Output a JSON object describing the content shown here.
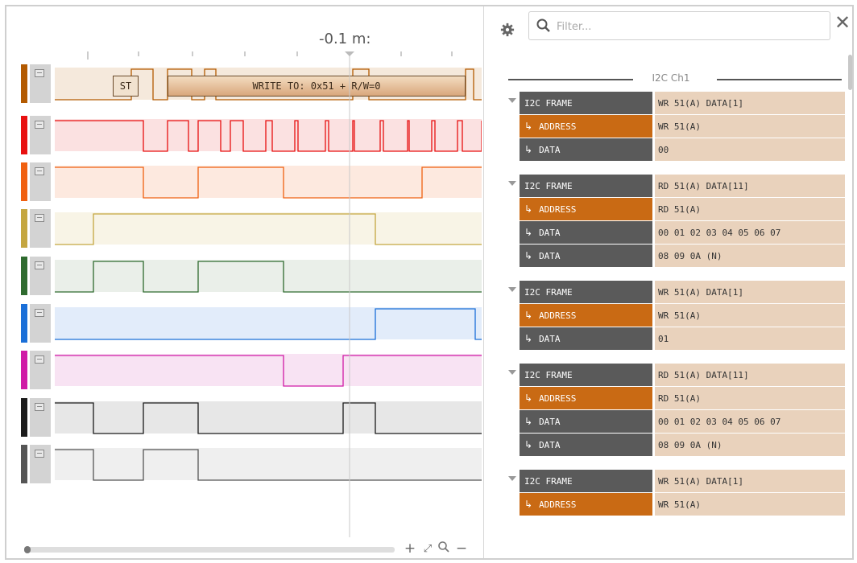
{
  "wave": {
    "time_label": "-0.1 m:",
    "start_label": "ST",
    "write_label": "WRITE TO: 0x51 + R/W=0",
    "channels": [
      {
        "color": "#b35a00",
        "bg": "#f5e9dc"
      },
      {
        "color": "#e81010",
        "bg": "#fbe1e1"
      },
      {
        "color": "#f06010",
        "bg": "#fde9df"
      },
      {
        "color": "#c4a640",
        "bg": "#f8f4e6"
      },
      {
        "color": "#2e6a2e",
        "bg": "#eaefe9"
      },
      {
        "color": "#1a6fd8",
        "bg": "#e2ecfa"
      },
      {
        "color": "#d01aa6",
        "bg": "#f8e3f3"
      },
      {
        "color": "#1b1b1b",
        "bg": "#e7e7e7"
      },
      {
        "color": "#555555",
        "bg": "#efefef"
      }
    ],
    "zoom_controls": [
      "+",
      "⤢",
      "🔍",
      "−"
    ]
  },
  "panel": {
    "filter_placeholder": "Filter...",
    "close_glyph": "✕",
    "group_name": "I2C Ch1",
    "frames": [
      {
        "label": "I2C FRAME",
        "value": "WR 51(A) DATA[1]",
        "children": [
          {
            "type": "address",
            "label": "ADDRESS",
            "value": "WR 51(A)"
          },
          {
            "type": "data",
            "label": "DATA",
            "value": "00"
          }
        ]
      },
      {
        "label": "I2C FRAME",
        "value": "RD 51(A) DATA[11]",
        "children": [
          {
            "type": "address",
            "label": "ADDRESS",
            "value": "RD 51(A)"
          },
          {
            "type": "data",
            "label": "DATA",
            "value": "00 01 02 03 04 05 06 07"
          },
          {
            "type": "data",
            "label": "DATA",
            "value": "08 09 0A (N)"
          }
        ]
      },
      {
        "label": "I2C FRAME",
        "value": "WR 51(A) DATA[1]",
        "children": [
          {
            "type": "address",
            "label": "ADDRESS",
            "value": "WR 51(A)"
          },
          {
            "type": "data",
            "label": "DATA",
            "value": "01"
          }
        ]
      },
      {
        "label": "I2C FRAME",
        "value": "RD 51(A) DATA[11]",
        "children": [
          {
            "type": "address",
            "label": "ADDRESS",
            "value": "RD 51(A)"
          },
          {
            "type": "data",
            "label": "DATA",
            "value": "00 01 02 03 04 05 06 07"
          },
          {
            "type": "data",
            "label": "DATA",
            "value": "08 09 0A (N)"
          }
        ]
      },
      {
        "label": "I2C FRAME",
        "value": "WR 51(A) DATA[1]",
        "children": [
          {
            "type": "address",
            "label": "ADDRESS",
            "value": "WR 51(A)"
          }
        ]
      }
    ]
  }
}
